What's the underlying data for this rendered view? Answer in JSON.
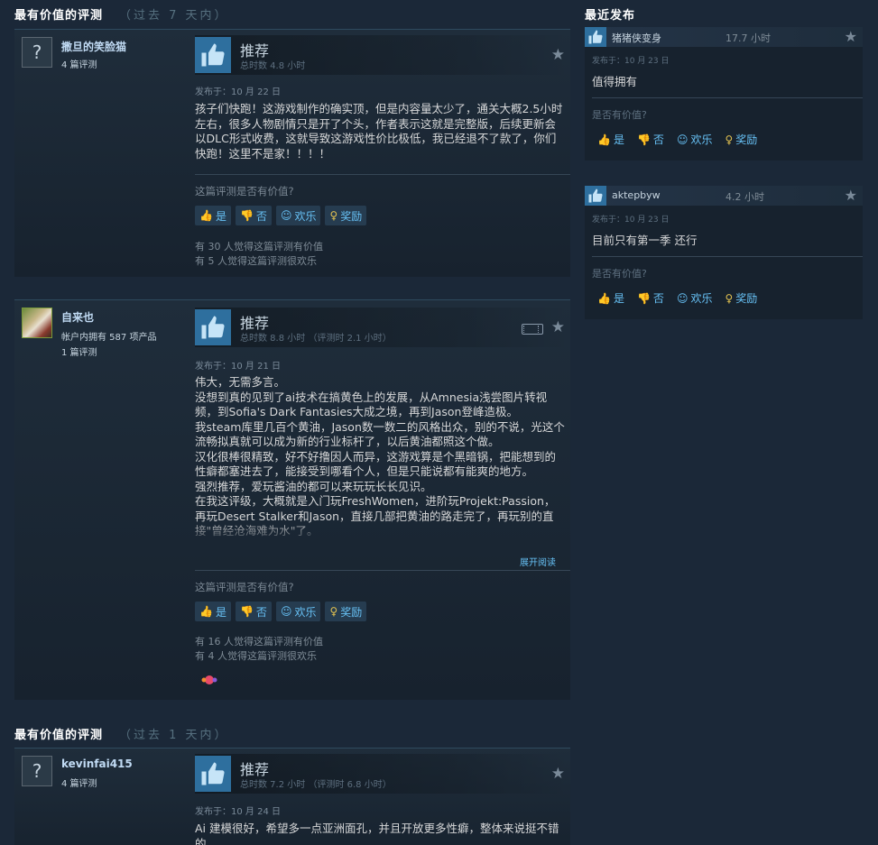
{
  "left_section_1": {
    "title": "最有价值的评测",
    "range": "（过去 7 天内）"
  },
  "left_section_2": {
    "title": "最有价值的评测",
    "range": "（过去 1 天内）"
  },
  "right_section": {
    "title": "最近发布"
  },
  "common": {
    "recommend": "推荐",
    "helpful_question": "这篇评测是否有价值?",
    "btn_yes": "是",
    "btn_no": "否",
    "btn_funny": "欢乐",
    "btn_award": "奖励",
    "expand": "展开阅读"
  },
  "reviews": [
    {
      "author": "撒旦的笑脸猫",
      "author_reviews": "4 篇评测",
      "hours": "总时数 4.8 小时",
      "posted": "发布于：10 月 22 日",
      "text": "孩子们快跑！这游戏制作的确实顶，但是内容量太少了，通关大概2.5小时左右，很多人物剧情只是开了个头，作者表示这就是完整版，后续更新会以DLC形式收费，这就导致这游戏性价比极低，我已经退不了款了，你们快跑！这里不是家！！！！",
      "helpful": "有 30 人觉得这篇评测有价值",
      "funny": "有 5 人觉得这篇评测很欢乐"
    },
    {
      "author": "自来也",
      "author_products": "帐户内拥有 587 项产品",
      "author_reviews": "1 篇评测",
      "hours": "总时数 8.8 小时 （评测时 2.1 小时）",
      "posted": "发布于：10 月 21 日",
      "lines": [
        "伟大，无需多言。",
        "没想到真的见到了ai技术在搞黄色上的发展，从Amnesia浅尝图片转视频，到Sofia's Dark Fantasies大成之境，再到Jason登峰造极。",
        "我steam库里几百个黄油，Jason数一数二的风格出众，别的不说，光这个流畅拟真就可以成为新的行业标杆了，以后黄油都照这个做。",
        "汉化很棒很精致，好不好撸因人而异，这游戏算是个黑暗锅，把能想到的性癖都塞进去了，能接受到哪看个人，但是只能说都有能爽的地方。",
        "强烈推荐，爱玩酱油的都可以来玩玩长长见识。",
        "在我这评级，大概就是入门玩FreshWomen，进阶玩Projekt:Passion，再玩Desert Stalker和Jason，直接几部把黄油的路走完了，再玩别的直接\"曾经沧海难为水\"了。"
      ],
      "helpful": "有 16 人觉得这篇评测有价值",
      "funny": "有 4 人觉得这篇评测很欢乐"
    },
    {
      "author": "kevinfai415",
      "author_reviews": "4 篇评测",
      "hours": "总时数 7.2 小时 （评测时 6.8 小时）",
      "posted": "发布于：10 月 24 日",
      "text": "Ai 建模很好，希望多一点亚洲面孔，并且开放更多性癖，整体来说挺不错的"
    }
  ],
  "recent": [
    {
      "name": "猪猪侠变身",
      "hours": "17.7 小时",
      "posted": "发布于：10 月 23 日",
      "text": "值得拥有",
      "question": "是否有价值?"
    },
    {
      "name": "aktepbyw",
      "hours": "4.2 小时",
      "posted": "发布于：10 月 23 日",
      "text": "目前只有第一季 还行",
      "question": "是否有价值?"
    }
  ],
  "colors": {
    "background": "#1b2838",
    "accent": "#67c1f5",
    "thumb": "#2e6f9e",
    "award": "#e0c050"
  },
  "icons": [
    "thumbs-up-icon",
    "thumbs-down-icon",
    "smile-icon",
    "award-icon",
    "star-icon",
    "video-icon",
    "unknown-avatar-icon"
  ]
}
